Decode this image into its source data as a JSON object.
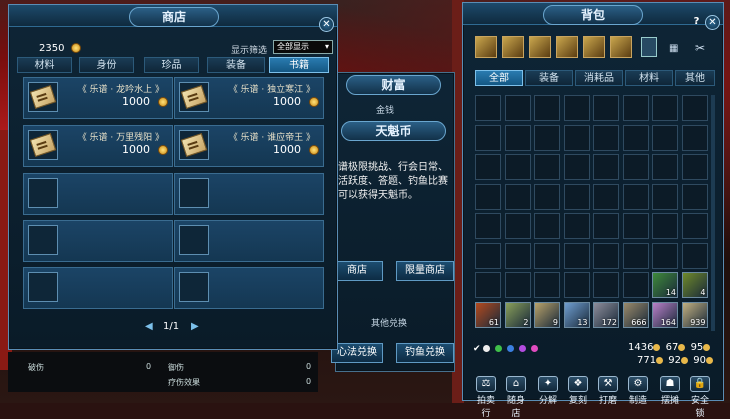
{
  "shop": {
    "title": "商店",
    "balance": "2350",
    "filter_label": "显示筛选",
    "filter_value": "全部显示",
    "tabs": [
      "材料",
      "身份",
      "珍品",
      "装备",
      "书籍"
    ],
    "active_tab": 4,
    "items": [
      {
        "name": "《 乐谱 · 龙吟水上 》",
        "price": "1000"
      },
      {
        "name": "《 乐谱 · 独立寒江 》",
        "price": "1000"
      },
      {
        "name": "《 乐谱 · 万里残阳 》",
        "price": "1000"
      },
      {
        "name": "《 乐谱 · 谁应帝王 》",
        "price": "1000"
      }
    ],
    "page": "1/1",
    "footer_labels": [
      "破伤",
      "0",
      "御伤",
      "0",
      "疗伤效果",
      "0"
    ]
  },
  "wealth": {
    "title": "财富",
    "subtitle": "金钱",
    "coin_title": "天魁币",
    "desc_lines": [
      "谱极限挑战、行会日常、",
      "活跃度、答题、钓鱼比赛",
      "可以获得天魁币。"
    ],
    "shop_btn": "商店",
    "limited_shop_btn": "限量商店",
    "other_exchange": "其他兑换",
    "heart_btn": "心法兑换",
    "fishing_btn": "钓鱼兑换"
  },
  "bag": {
    "title": "背包",
    "tabs": [
      "全部",
      "装备",
      "消耗品",
      "材料",
      "其他"
    ],
    "active_tab": 0,
    "items": [
      {
        "count": "14",
        "color": "#3f8a3a"
      },
      {
        "count": "4",
        "color": "#6f8a2a"
      },
      {
        "count": "61",
        "color": "#b44a1e"
      },
      {
        "count": "2",
        "color": "#8aa05a"
      },
      {
        "count": "9",
        "color": "#b8a26a"
      },
      {
        "count": "13",
        "color": "#6f9ed0"
      },
      {
        "count": "172",
        "color": "#8d8d9a"
      },
      {
        "count": "666",
        "color": "#9a8a6a"
      },
      {
        "count": "164",
        "color": "#b880c8"
      },
      {
        "count": "939",
        "color": "#c2b080"
      }
    ],
    "stats_row1": [
      "1436",
      "67",
      "95"
    ],
    "stats_row2": [
      "771",
      "92",
      "90"
    ],
    "func_buttons": [
      "拍卖行",
      "随身店",
      "分解",
      "复刻",
      "打磨",
      "制造",
      "摆摊",
      "安全锁"
    ]
  },
  "colors": {
    "accent": "#2a7bb0",
    "gold": "#e8b84a",
    "panel": "#0e2536"
  }
}
